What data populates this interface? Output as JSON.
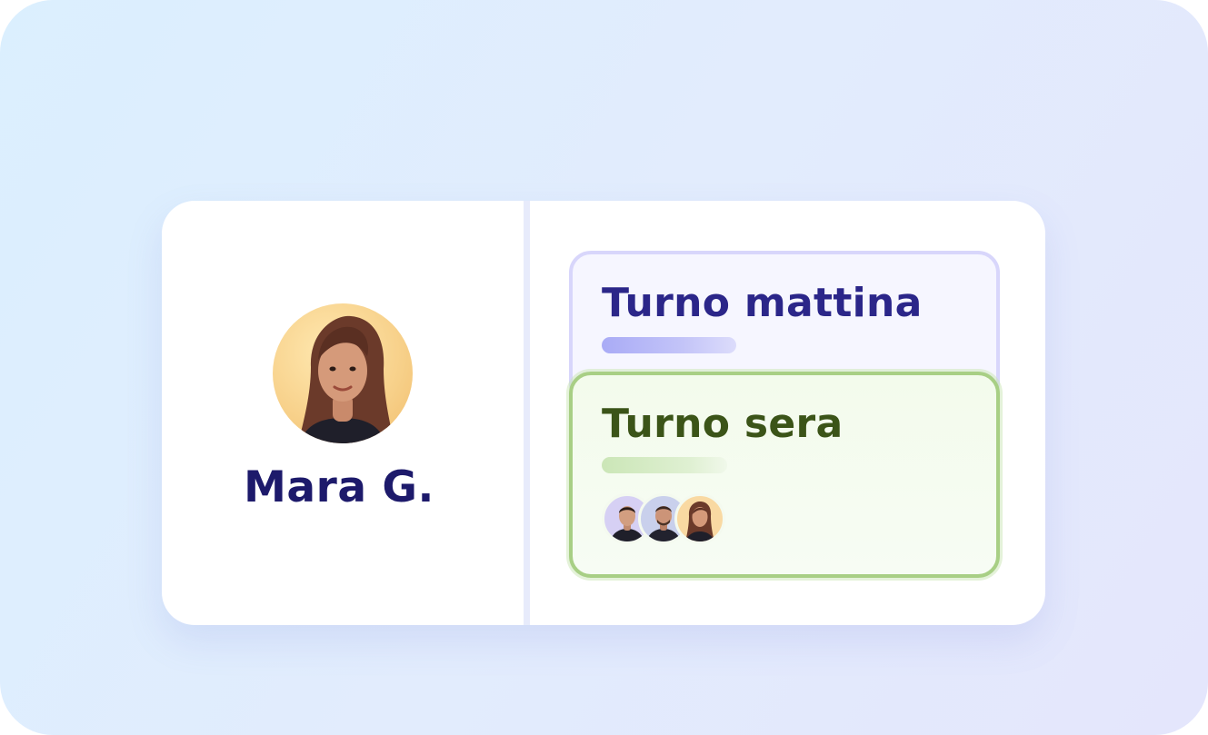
{
  "profile": {
    "name": "Mara G.",
    "avatar_icon": "person-photo-icon"
  },
  "shifts": [
    {
      "title": "Turno mattina",
      "accent": "#2b2689",
      "border": "#d8d6fb"
    },
    {
      "title": "Turno sera",
      "accent": "#3b5418",
      "border": "#a8cf85",
      "assigned_avatars": [
        "person-photo-icon",
        "person-photo-icon",
        "person-photo-icon"
      ]
    }
  ],
  "colors": {
    "background_from": "#dbeffe",
    "background_to": "#e4e6fc",
    "name_text": "#1d1a6b"
  }
}
